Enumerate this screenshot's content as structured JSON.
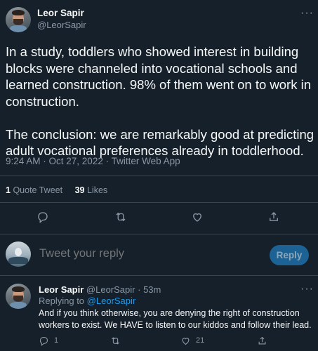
{
  "author": {
    "name": "Leor Sapir",
    "handle": "@LeorSapir"
  },
  "tweet": {
    "paragraph1": "In a study, toddlers who showed interest in building blocks were channeled into vocational schools and learned construction. 98% of them went on to work in construction.",
    "paragraph2": "The conclusion: we are remarkably good at predicting adult vocational preferences already in toddlerhood.",
    "meta": "9:24 AM · Oct 27, 2022 · Twitter Web App"
  },
  "stats": {
    "quote_count": "1",
    "quote_label": "Quote Tweet",
    "likes_count": "39",
    "likes_label": "Likes"
  },
  "compose": {
    "placeholder": "Tweet your reply",
    "button": "Reply"
  },
  "reply": {
    "name": "Leor Sapir",
    "handle": "@LeorSapir",
    "time": "· 53m",
    "replying_prefix": "Replying to",
    "replying_to": "@LeorSapir",
    "body": "And if you think otherwise, you are denying the right of construction workers to exist. We HAVE to listen to our kiddos and follow their lead.",
    "reply_count": "1",
    "like_count": "21"
  },
  "icons": {
    "more": "more-dots-icon",
    "reply": "comment-icon",
    "retweet": "retweet-icon",
    "like": "heart-icon",
    "share": "share-icon"
  },
  "colors": {
    "background": "#15202b",
    "text": "#f7f9f9",
    "muted": "#8b98a5",
    "accent": "#1d9bf0",
    "reply_button": "#1d6295",
    "divider": "#38444d"
  }
}
